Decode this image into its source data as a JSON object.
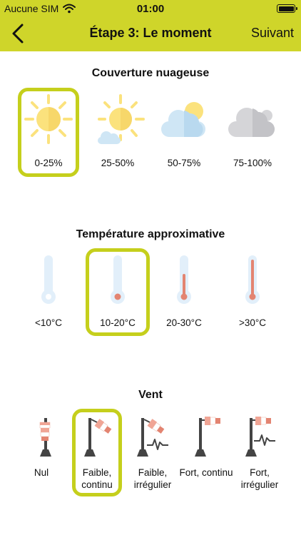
{
  "status_bar": {
    "carrier": "Aucune SIM",
    "time": "01:00"
  },
  "nav": {
    "title": "Étape 3: Le moment",
    "next_label": "Suivant"
  },
  "colors": {
    "accent": "#cfd52a",
    "selection": "#c5cf1c",
    "sun": "#fbe27d",
    "cloud": "#cfe6f5",
    "grey_cloud": "#d5d5d8",
    "thermo": "#e2effa",
    "mercury": "#e38471"
  },
  "clouds": {
    "title": "Couverture nuageuse",
    "selected": 0,
    "options": [
      {
        "label": "0-25%",
        "icon": "sun-icon"
      },
      {
        "label": "25-50%",
        "icon": "sun-small-cloud-icon"
      },
      {
        "label": "50-75%",
        "icon": "cloud-sun-icon"
      },
      {
        "label": "75-100%",
        "icon": "grey-cloud-icon"
      }
    ]
  },
  "temperature": {
    "title": "Température approximative",
    "selected": 1,
    "options": [
      {
        "label": "<10°C",
        "icon": "thermometer-empty-icon"
      },
      {
        "label": "10-20°C",
        "icon": "thermometer-low-icon"
      },
      {
        "label": "20-30°C",
        "icon": "thermometer-mid-icon"
      },
      {
        "label": ">30°C",
        "icon": "thermometer-high-icon"
      }
    ]
  },
  "wind": {
    "title": "Vent",
    "selected": 1,
    "options": [
      {
        "label": "Nul",
        "icon": "windsock-calm-icon"
      },
      {
        "label": "Faible, continu",
        "icon": "windsock-light-steady-icon"
      },
      {
        "label": "Faible, irrégulier",
        "icon": "windsock-light-gusty-icon"
      },
      {
        "label": "Fort, continu",
        "icon": "windsock-strong-steady-icon"
      },
      {
        "label": "Fort, irrégulier",
        "icon": "windsock-strong-gusty-icon"
      }
    ]
  }
}
